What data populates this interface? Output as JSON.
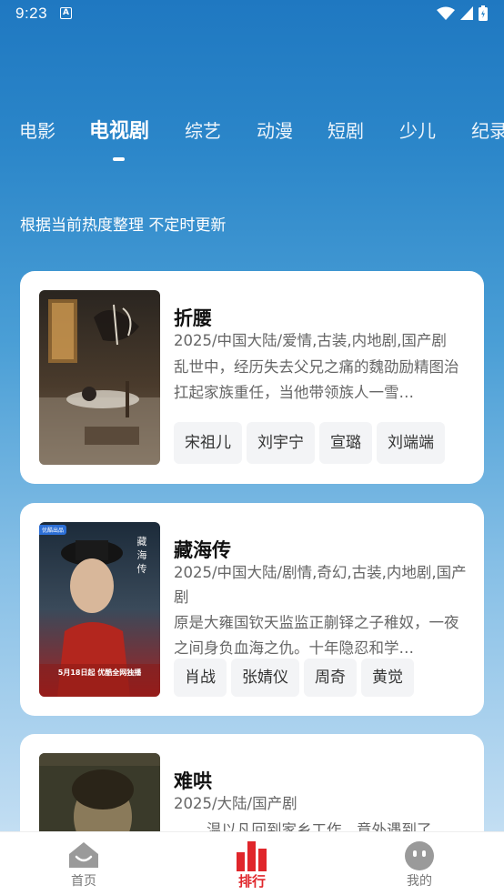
{
  "status_bar": {
    "time": "9:23",
    "notification_glyph": "A"
  },
  "tabs": [
    {
      "label": "电影",
      "active": false
    },
    {
      "label": "电视剧",
      "active": true
    },
    {
      "label": "综艺",
      "active": false
    },
    {
      "label": "动漫",
      "active": false
    },
    {
      "label": "短剧",
      "active": false
    },
    {
      "label": "少儿",
      "active": false
    },
    {
      "label": "纪录",
      "active": false
    }
  ],
  "subtitle": "根据当前热度整理 不定时更新",
  "items": [
    {
      "title": "折腰",
      "meta": "2025/中国大陆/爱情,古装,内地剧,国产剧",
      "description": "乱世中，经历失去父兄之痛的魏劭励精图治扛起家族重任，当他带领族人一雪…",
      "cast": [
        "宋祖儿",
        "刘宇宁",
        "宣璐",
        "刘端端"
      ]
    },
    {
      "title": "藏海传",
      "meta": "2025/中国大陆/剧情,奇幻,古装,内地剧,国产剧",
      "description": "原是大雍国钦天监监正蒯铎之子稚奴，一夜之间身负血海之仇。十年隐忍和学…",
      "cast": [
        "肖战",
        "张婧仪",
        "周奇",
        "黄觉"
      ],
      "poster_badge": "优酷出品",
      "poster_text": "5月18日起 优酷全网独播"
    },
    {
      "title": "难哄",
      "meta": "2025/大陆/国产剧",
      "description": "温以凡回到家乡工作，意外遇到了…"
    }
  ],
  "bottom_nav": [
    {
      "label": "首页",
      "icon": "home-face-icon",
      "active": false
    },
    {
      "label": "排行",
      "icon": "ranking-bars-icon",
      "active": true
    },
    {
      "label": "我的",
      "icon": "profile-face-icon",
      "active": false
    }
  ],
  "colors": {
    "accent": "#e0262b",
    "header_blue": "#1f78c1",
    "card_bg": "#ffffff"
  }
}
